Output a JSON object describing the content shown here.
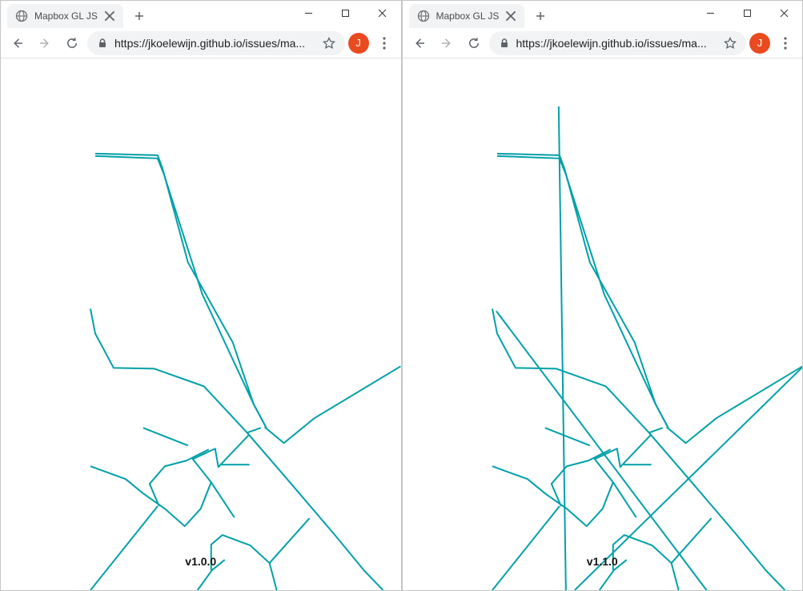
{
  "left": {
    "tab_title": "Mapbox GL JS",
    "url_display": "https://jkoelewijn.github.io/issues/ma...",
    "avatar_letter": "J",
    "version_label": "v1.0.0",
    "stroke_color": "#00a0a8"
  },
  "right": {
    "tab_title": "Mapbox GL JS",
    "url_display": "https://jkoelewijn.github.io/issues/ma...",
    "avatar_letter": "J",
    "version_label": "v1.1.0",
    "stroke_color": "#00a0a8"
  }
}
